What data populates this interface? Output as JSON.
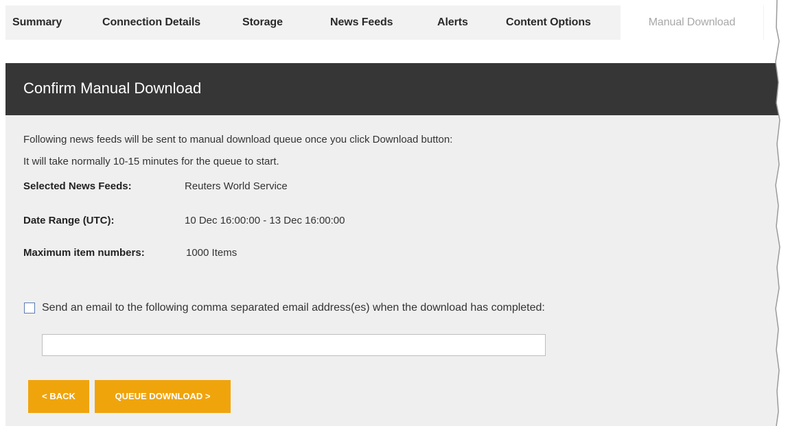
{
  "tabs": [
    {
      "label": "Summary"
    },
    {
      "label": "Connection Details"
    },
    {
      "label": "Storage"
    },
    {
      "label": "News Feeds"
    },
    {
      "label": "Alerts"
    },
    {
      "label": "Content Options"
    },
    {
      "label": "Manual Download",
      "active": true
    }
  ],
  "header": {
    "title": "Confirm Manual Download"
  },
  "intro": {
    "line1": "Following news feeds will be sent to manual download queue once you click Download button:",
    "line2": "It will take normally 10-15 minutes for the queue to start."
  },
  "details": {
    "feeds_label": "Selected News Feeds:",
    "feeds_value": "Reuters World Service",
    "range_label": "Date Range (UTC):",
    "range_value": "10 Dec 16:00:00 - 13 Dec 16:00:00",
    "max_label": "Maximum item numbers:",
    "max_value": "1000 Items"
  },
  "email": {
    "checked": false,
    "label": "Send an email to the following comma separated email address(es) when the download has completed:",
    "value": "",
    "placeholder": ""
  },
  "buttons": {
    "back": "< BACK",
    "queue": "QUEUE DOWNLOAD >"
  },
  "colors": {
    "accent": "#f0a40c",
    "header_bg": "#363636",
    "panel_bg": "#efefef"
  }
}
